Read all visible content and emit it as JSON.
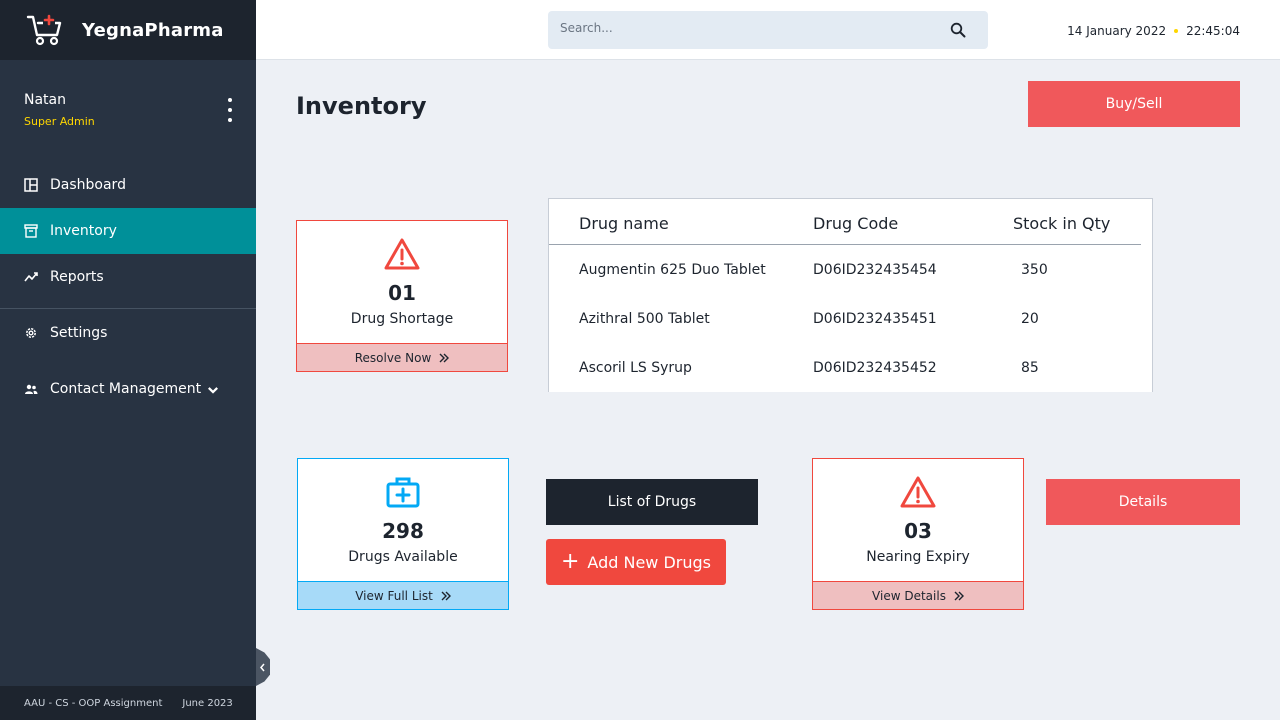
{
  "app": {
    "brand_name": "YegnaPharma",
    "logo_icon": "medical-cart-icon"
  },
  "user": {
    "name": "Natan",
    "role": "Super Admin"
  },
  "sidebar": {
    "items": [
      {
        "label": "Dashboard",
        "icon": "dashboard-icon"
      },
      {
        "label": "Inventory",
        "icon": "inventory-icon",
        "active": true
      },
      {
        "label": "Reports",
        "icon": "reports-icon"
      },
      {
        "label": "Settings",
        "icon": "gear-icon"
      },
      {
        "label": "Contact Management",
        "icon": "users-icon"
      }
    ],
    "footer": {
      "text": "AAU - CS - OOP Assignment",
      "date": "June 2023"
    }
  },
  "header": {
    "search_placeholder": "Search...",
    "date": "14 January 2022",
    "time": "22:45:04"
  },
  "main": {
    "title": "Inventory",
    "buy_sell_label": "Buy/Sell",
    "list_of_drugs_label": "List of Drugs",
    "add_new_drugs_label": "Add New Drugs",
    "details_label": "Details"
  },
  "cards": {
    "shortage": {
      "number": "01",
      "label": "Drug Shortage",
      "action": "Resolve Now"
    },
    "available": {
      "number": "298",
      "label": "Drugs Available",
      "action": "View Full List"
    },
    "expiry": {
      "number": "03",
      "label": "Nearing Expiry",
      "action": "View Details"
    }
  },
  "table": {
    "headers": [
      "Drug name",
      "Drug Code",
      "Stock in Qty"
    ],
    "rows": [
      {
        "name": "Augmentin 625 Duo Tablet",
        "code": "D06ID232435454",
        "qty": "350"
      },
      {
        "name": "Azithral 500 Tablet",
        "code": "D06ID232435451",
        "qty": "20"
      },
      {
        "name": "Ascoril LS Syrup",
        "code": "D06ID232435452",
        "qty": "85"
      }
    ]
  },
  "colors": {
    "sidebar_bg": "#283342",
    "sidebar_dark": "#1D242E",
    "active_teal": "#009099",
    "accent_red": "#F0483E",
    "accent_blue": "#03A9F5",
    "role_yellow": "#FED600"
  }
}
